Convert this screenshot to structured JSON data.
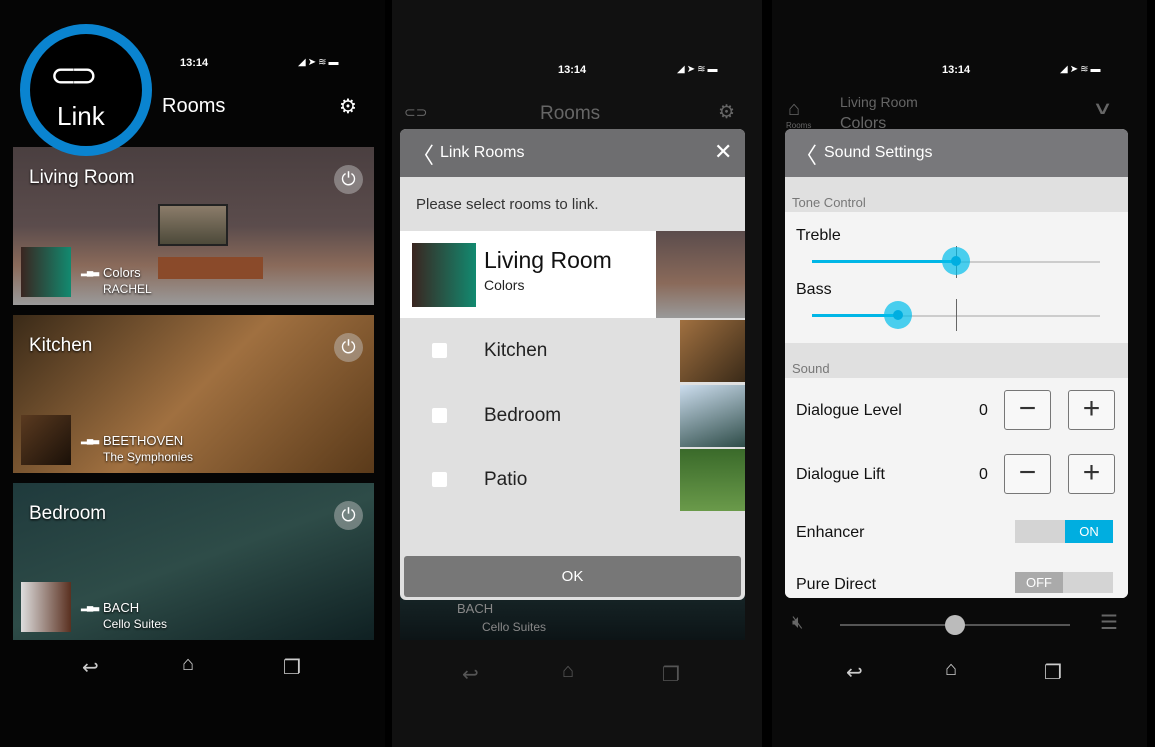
{
  "phone1": {
    "time": "13:14",
    "header": "Rooms",
    "link_badge": "Link",
    "rooms": [
      {
        "name": "Living Room",
        "track": "Colors",
        "artist": "RACHEL"
      },
      {
        "name": "Kitchen",
        "track": "BEETHOVEN",
        "artist": "The Symphonies"
      },
      {
        "name": "Bedroom",
        "track": "BACH",
        "artist": "Cello Suites"
      }
    ]
  },
  "phone2": {
    "time": "13:14",
    "header": "Rooms",
    "link_icon_label": "Link",
    "dialog": {
      "title": "Link Rooms",
      "prompt": "Please select rooms to link.",
      "current": {
        "name": "Living Room",
        "track": "Colors"
      },
      "rooms": [
        {
          "name": "Kitchen",
          "checked": false
        },
        {
          "name": "Bedroom",
          "checked": false
        },
        {
          "name": "Patio",
          "checked": false
        }
      ],
      "ok": "OK"
    },
    "behind": {
      "track": "BACH",
      "artist": "Cello Suites"
    }
  },
  "phone3": {
    "time": "13:14",
    "rooms_icon_label": "Rooms",
    "room": "Living Room",
    "track": "Colors",
    "panel": {
      "title": "Sound Settings",
      "tone_section": "Tone Control",
      "treble": {
        "label": "Treble",
        "value_fraction": 0.5
      },
      "bass": {
        "label": "Bass",
        "value_fraction": 0.3
      },
      "sound_section": "Sound",
      "dialogue_level": {
        "label": "Dialogue Level",
        "value": "0"
      },
      "dialogue_lift": {
        "label": "Dialogue Lift",
        "value": "0"
      },
      "enhancer": {
        "label": "Enhancer",
        "state": "ON"
      },
      "pure_direct": {
        "label": "Pure Direct",
        "state": "OFF"
      }
    },
    "volume_fraction": 0.5
  },
  "colors": {
    "accent": "#00b6e6",
    "link_ring": "#0a84d0"
  }
}
